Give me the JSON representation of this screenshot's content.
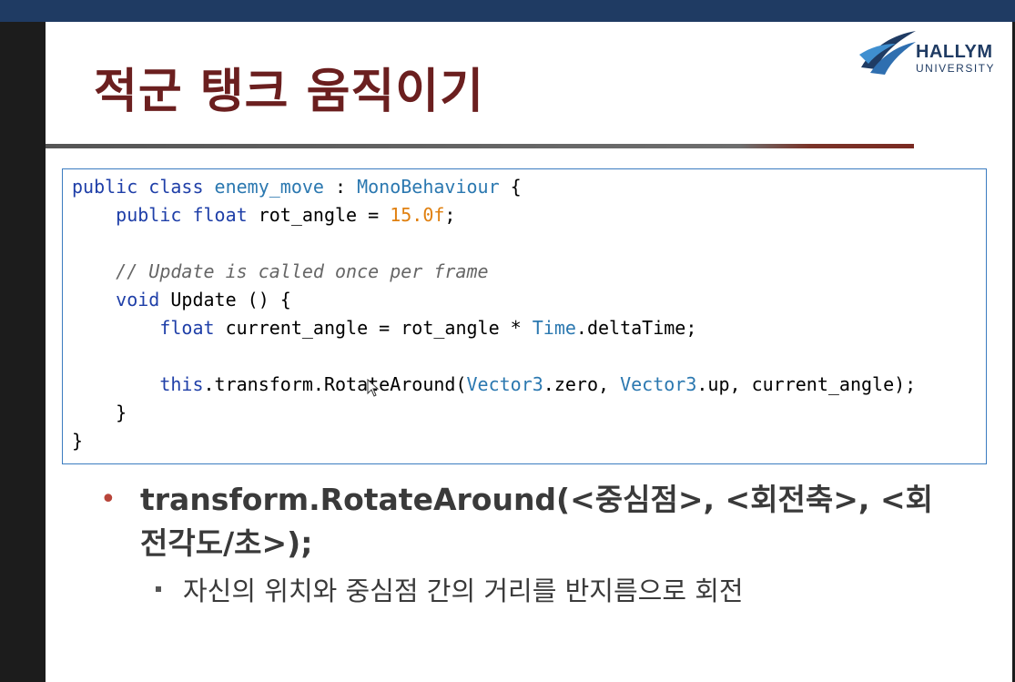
{
  "slide": {
    "title": "적군 탱크 움직이기"
  },
  "logo": {
    "name": "HALLYM",
    "subtitle": "UNIVERSITY"
  },
  "code": {
    "line1": {
      "a": "public class ",
      "b": "enemy_move",
      "c": " : ",
      "d": "MonoBehaviour",
      "e": " {"
    },
    "line2": {
      "a": "    public float ",
      "b": "rot_angle = ",
      "c": "15.0f",
      "d": ";"
    },
    "line3": {
      "a": "    // Update is called once per frame"
    },
    "line4": {
      "a": "    void ",
      "b": "Update () {"
    },
    "line5": {
      "a": "        float ",
      "b": "current_angle = rot_angle * ",
      "c": "Time",
      "d": ".deltaTime;"
    },
    "line6": {
      "a": "        this",
      "b": ".transform.RotateAround(",
      "c": "Vector3",
      "d": ".zero, ",
      "e": "Vector3",
      "f": ".up, current_angle);"
    },
    "line7": {
      "a": "    }"
    },
    "line8": {
      "a": "}"
    }
  },
  "bullets": {
    "main": "transform.RotateAround(<중심점>, <회전축>, <회전각도/초>);",
    "main_marker": "•",
    "sub": "자신의 위치와 중심점 간의 거리를 반지름으로 회전"
  },
  "colors": {
    "title": "#6b1f1f",
    "top_bar": "#1f3b63",
    "code_border": "#3b7cc0",
    "keyword": "#1f3fa8",
    "type": "#2b78b0",
    "number": "#e08010",
    "bullet_marker": "#b8453a"
  }
}
